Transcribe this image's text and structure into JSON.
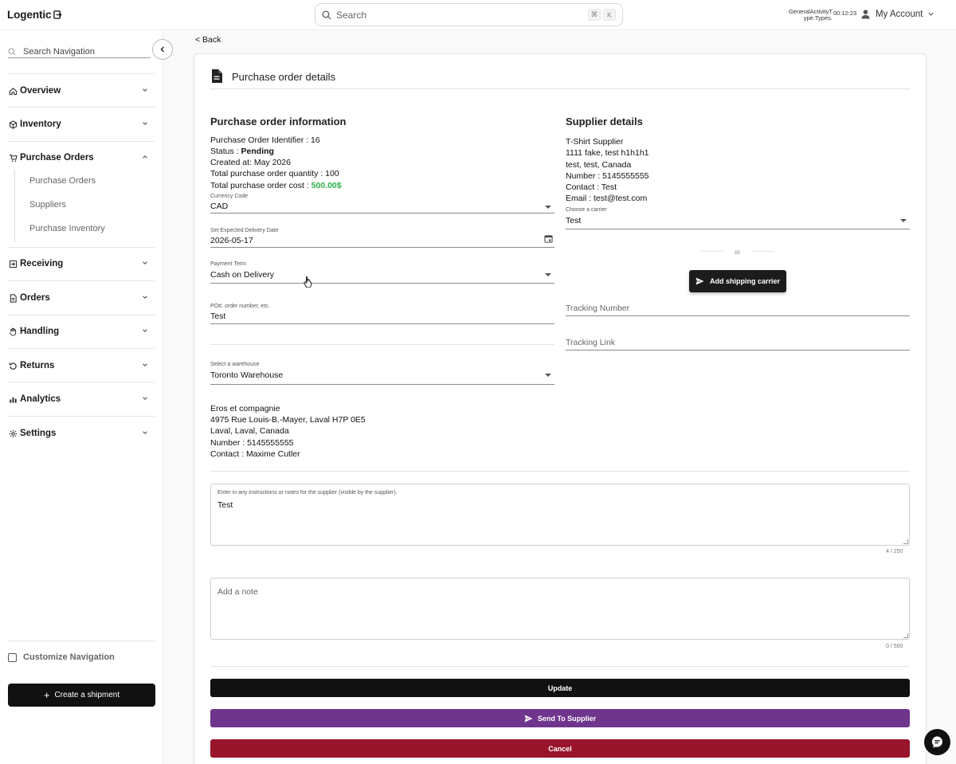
{
  "app": {
    "logo_text": "Logentic"
  },
  "topbar": {
    "search_placeholder": "Search",
    "shortcut_keys": [
      "⌘",
      "K"
    ],
    "activity_label_1": "GeneralActivityT",
    "activity_label_2": "ype.Types.",
    "timer": "00:12:23",
    "account_label": "My Account"
  },
  "sidebar": {
    "search_placeholder": "Search Navigation",
    "items": [
      {
        "label": "Overview",
        "icon": "home-icon"
      },
      {
        "label": "Inventory",
        "icon": "box-icon"
      },
      {
        "label": "Purchase Orders",
        "icon": "cart-icon",
        "expanded": true
      },
      {
        "label": "Receiving",
        "icon": "receive-icon"
      },
      {
        "label": "Orders",
        "icon": "document-icon"
      },
      {
        "label": "Handling",
        "icon": "hand-icon"
      },
      {
        "label": "Returns",
        "icon": "return-icon"
      },
      {
        "label": "Analytics",
        "icon": "analytics-icon"
      },
      {
        "label": "Settings",
        "icon": "gear-icon"
      }
    ],
    "sub_items": [
      "Purchase Orders",
      "Suppliers",
      "Purchase Inventory"
    ],
    "customize_label": "Customize Navigation",
    "create_shipment_label": "Create a shipment"
  },
  "page": {
    "back_label": "< Back",
    "title": "Purchase order details"
  },
  "po_info": {
    "heading": "Purchase order information",
    "identifier_label": "Purchase Order Identifier : 16",
    "status_label": "Status : ",
    "status_value": "Pending",
    "created_label": "Created at: May 2026",
    "quantity_label": "Total purchase order quantity : 100",
    "cost_label": "Total purchase order cost : ",
    "cost_value": "500.00$"
  },
  "form": {
    "currency": {
      "label": "Currency Code",
      "value": "CAD"
    },
    "delivery_date": {
      "label": "Set Expected Delivery Date",
      "value": "2026-05-17"
    },
    "payment_term": {
      "label": "Payment Term",
      "value": "Cash on Delivery"
    },
    "po_number": {
      "label": "PO#, order number, etc.",
      "value": "Test"
    },
    "warehouse": {
      "label": "Select a warehouse",
      "value": "Toronto Warehouse"
    }
  },
  "warehouse_address": {
    "name": "Eros et compagnie",
    "street": "4975 Rue Louis-B.-Mayer, Laval H7P 0E5",
    "city": "Laval, Laval, Canada",
    "number": "Number : 5145555555",
    "contact": "Contact : Maxime Cutler"
  },
  "supplier": {
    "heading": "Supplier details",
    "name": "T-Shirt Supplier",
    "street": "1111 fake, test h1h1h1",
    "city": "test, test, Canada",
    "number": "Number : 5145555555",
    "contact": "Contact : Test",
    "email": "Email : test@test.com",
    "carrier": {
      "label": "Choose a carrier",
      "value": "Test"
    },
    "or_label": "or",
    "add_carrier_label": "Add shipping carrier",
    "tracking_number_placeholder": "Tracking Number",
    "tracking_link_placeholder": "Tracking Link"
  },
  "notes": {
    "supplier_note_label": "Enter in any instructions or notes for the supplier (visible by the supplier).",
    "supplier_note_value": "Test",
    "supplier_note_counter": "4 / 250",
    "note_placeholder": "Add a note",
    "note_counter": "0 / 500"
  },
  "actions": {
    "update_label": "Update",
    "send_label": "Send To Supplier",
    "cancel_label": "Cancel"
  },
  "colors": {
    "primary": "#111111",
    "send": "#6f358c",
    "cancel": "#98142a",
    "cost_green": "#2bb24c"
  }
}
